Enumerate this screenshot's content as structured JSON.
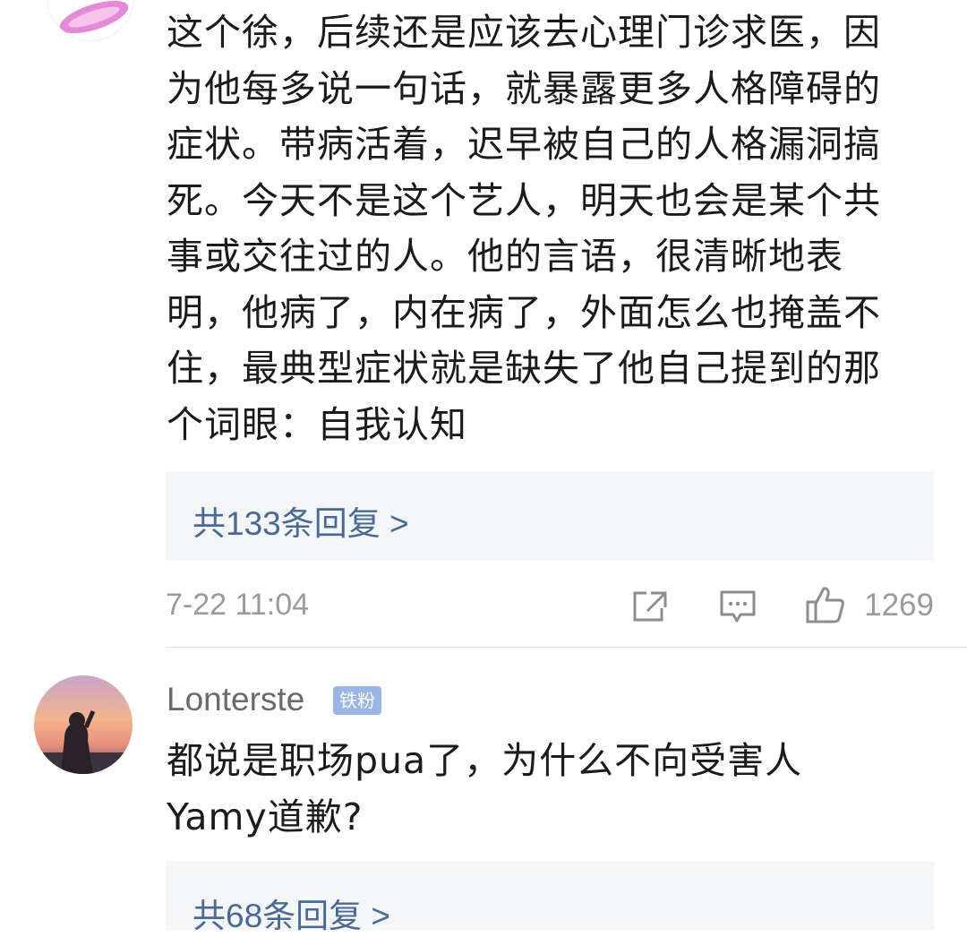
{
  "comment1": {
    "lines": [
      "这个徐，后续还是应该去心理门诊求医，因",
      "为他每多说一句话，就暴露更多人格障碍的",
      "症状。带病活着，迟早被自己的人格漏洞搞",
      "死。今天不是这个艺人，明天也会是某个共",
      "事或交往过的人。他的言语，很清晰地表",
      "明，他病了，内在病了，外面怎么也掩盖不",
      "住，最典型症状就是缺失了他自己提到的那",
      "个词眼：自我认知"
    ],
    "replies_label": "共133条回复 >",
    "timestamp": "7-22 11:04",
    "likes": "1269"
  },
  "comment2": {
    "username": "Lonterste",
    "badge": "铁粉",
    "lines": [
      "都说是职场pua了，为什么不向受害人",
      "Yamy道歉?"
    ],
    "replies_label": "共68条回复 >"
  },
  "colors": {
    "link": "#476a99",
    "meta_gray": "#9a9a9a",
    "reply_bg": "#f5f6f7",
    "badge_bg": "#9bb6e6"
  },
  "icons": [
    "share-icon",
    "comment-icon",
    "thumbs-up-icon"
  ]
}
